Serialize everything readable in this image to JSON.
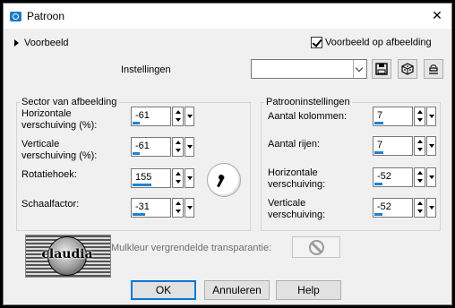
{
  "window": {
    "title": "Patroon",
    "close_glyph": "✕",
    "icon": "camera-icon"
  },
  "preview": {
    "label": "Voorbeeld",
    "on_image_label": "Voorbeeld op afbeelding",
    "on_image_checked": true
  },
  "settings": {
    "label": "Instellingen",
    "preset_value": ""
  },
  "toolbar": {
    "save_icon": "save-icon",
    "random_icon": "dice-icon",
    "reset_icon": "reset-icon"
  },
  "sector": {
    "title": "Sector van afbeelding",
    "h_offset": {
      "label_1": "Horizontale",
      "label_2": "verschuiving (%):",
      "value": "-61",
      "level": 0.2
    },
    "v_offset": {
      "label_1": "Verticale",
      "label_2": "verschuiving (%):",
      "value": "-61",
      "level": 0.2
    },
    "rotation": {
      "label": "Rotatiehoek:",
      "value": "155",
      "level": 0.5
    },
    "scale": {
      "label": "Schaalfactor:",
      "value": "-31",
      "level": 0.35
    }
  },
  "pattern": {
    "title": "Patrooninstellingen",
    "columns": {
      "label": "Aantal kolommen:",
      "value": "7",
      "level": 0.25
    },
    "rows": {
      "label": "Aantal rijen:",
      "value": "7",
      "level": 0.25
    },
    "h_offset": {
      "label_1": "Horizontale",
      "label_2": "verschuiving:",
      "value": "-52",
      "level": 0.22
    },
    "v_offset": {
      "label_1": "Verticale",
      "label_2": "verschuiving:",
      "value": "-52",
      "level": 0.22
    }
  },
  "logo": {
    "text": "claudia"
  },
  "transparency": {
    "label": "Mulkleur vergrendelde transparantie:",
    "icon": "no-entry-icon"
  },
  "buttons": {
    "ok": "OK",
    "cancel": "Annuleren",
    "help": "Help"
  },
  "colors": {
    "accent": "#0078d7",
    "slider": "#1e82d6",
    "panel": "#f0f0f0"
  }
}
